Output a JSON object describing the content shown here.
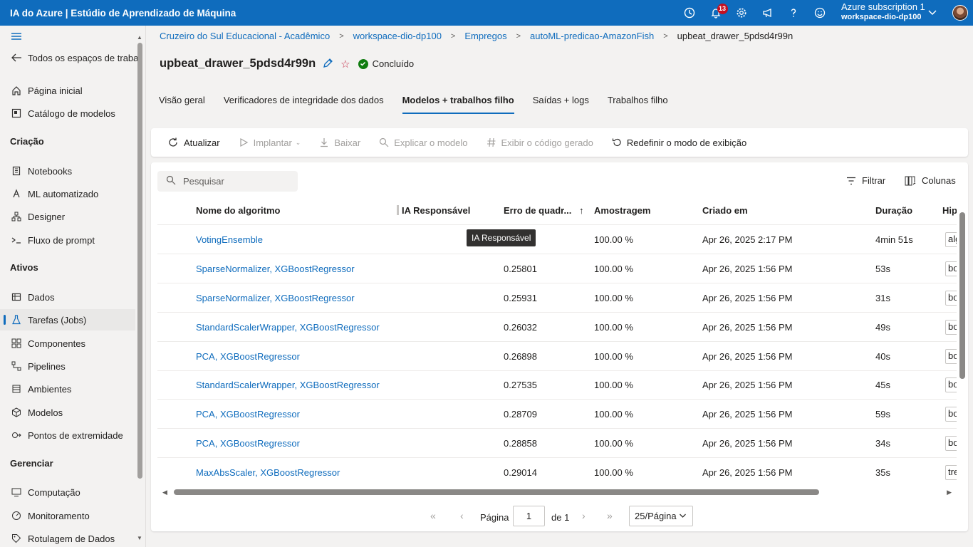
{
  "topbar": {
    "brand": "IA do Azure | Estúdio de Aprendizado de Máquina",
    "notification_count": "13",
    "subscription": "Azure subscription 1",
    "workspace": "workspace-dio-dp100",
    "icons": [
      "clock-icon",
      "bell-icon",
      "gear-icon",
      "megaphone-icon",
      "help-icon",
      "smiley-icon"
    ]
  },
  "sidebar": {
    "back_label": "Todos os espaços de trabal",
    "home": "Página inicial",
    "catalog": "Catálogo de modelos",
    "section_create": "Criação",
    "notebooks": "Notebooks",
    "automl": "ML automatizado",
    "designer": "Designer",
    "prompt_flow": "Fluxo de prompt",
    "section_assets": "Ativos",
    "data": "Dados",
    "jobs": "Tarefas (Jobs)",
    "components": "Componentes",
    "pipelines": "Pipelines",
    "environments": "Ambientes",
    "models": "Modelos",
    "endpoints": "Pontos de extremidade",
    "section_manage": "Gerenciar",
    "compute": "Computação",
    "monitoring": "Monitoramento",
    "labeling": "Rotulagem de Dados"
  },
  "breadcrumb": [
    "Cruzeiro do Sul Educacional - Acadêmico",
    "workspace-dio-dp100",
    "Empregos",
    "autoML-predicao-AmazonFish",
    "upbeat_drawer_5pdsd4r99n"
  ],
  "page": {
    "title": "upbeat_drawer_5pdsd4r99n",
    "status": "Concluído"
  },
  "tabs": [
    "Visão geral",
    "Verificadores de integridade dos dados",
    "Modelos + trabalhos filho",
    "Saídas + logs",
    "Trabalhos filho"
  ],
  "active_tab": "Modelos + trabalhos filho",
  "toolbar": {
    "refresh": "Atualizar",
    "deploy": "Implantar",
    "download": "Baixar",
    "explain": "Explicar o modelo",
    "code": "Exibir o código gerado",
    "reset": "Redefinir o modo de exibição"
  },
  "search": {
    "placeholder": "Pesquisar"
  },
  "filter_label": "Filtrar",
  "columns_label": "Colunas",
  "table": {
    "headers": {
      "algorithm": "Nome do algoritmo",
      "responsible": "IA Responsável",
      "error": "Erro de quadr...",
      "sampling": "Amostragem",
      "created": "Criado em",
      "duration": "Duração",
      "hyper": "Hip"
    },
    "rows": [
      {
        "algorithm": "VotingEnsemble",
        "error": "",
        "sampling": "100.00 %",
        "created": "Apr 26, 2025 2:17 PM",
        "duration": "4min 51s",
        "hyper": "alg"
      },
      {
        "algorithm": "SparseNormalizer, XGBoostRegressor",
        "error": "0.25801",
        "sampling": "100.00 %",
        "created": "Apr 26, 2025 1:56 PM",
        "duration": "53s",
        "hyper": "bo"
      },
      {
        "algorithm": "SparseNormalizer, XGBoostRegressor",
        "error": "0.25931",
        "sampling": "100.00 %",
        "created": "Apr 26, 2025 1:56 PM",
        "duration": "31s",
        "hyper": "bo"
      },
      {
        "algorithm": "StandardScalerWrapper, XGBoostRegressor",
        "error": "0.26032",
        "sampling": "100.00 %",
        "created": "Apr 26, 2025 1:56 PM",
        "duration": "49s",
        "hyper": "bo"
      },
      {
        "algorithm": "PCA, XGBoostRegressor",
        "error": "0.26898",
        "sampling": "100.00 %",
        "created": "Apr 26, 2025 1:56 PM",
        "duration": "40s",
        "hyper": "bo"
      },
      {
        "algorithm": "StandardScalerWrapper, XGBoostRegressor",
        "error": "0.27535",
        "sampling": "100.00 %",
        "created": "Apr 26, 2025 1:56 PM",
        "duration": "45s",
        "hyper": "bo"
      },
      {
        "algorithm": "PCA, XGBoostRegressor",
        "error": "0.28709",
        "sampling": "100.00 %",
        "created": "Apr 26, 2025 1:56 PM",
        "duration": "59s",
        "hyper": "bo"
      },
      {
        "algorithm": "PCA, XGBoostRegressor",
        "error": "0.28858",
        "sampling": "100.00 %",
        "created": "Apr 26, 2025 1:56 PM",
        "duration": "34s",
        "hyper": "bo"
      },
      {
        "algorithm": "MaxAbsScaler, XGBoostRegressor",
        "error": "0.29014",
        "sampling": "100.00 %",
        "created": "Apr 26, 2025 1:56 PM",
        "duration": "35s",
        "hyper": "tre"
      }
    ]
  },
  "tooltip": "IA Responsável",
  "pager": {
    "page_label": "Página",
    "page_value": "1",
    "of_label": "de 1",
    "page_size": "25/Página"
  },
  "colors": {
    "accent": "#0f6cbd",
    "success": "#107c10",
    "badge": "#c50f1f"
  }
}
